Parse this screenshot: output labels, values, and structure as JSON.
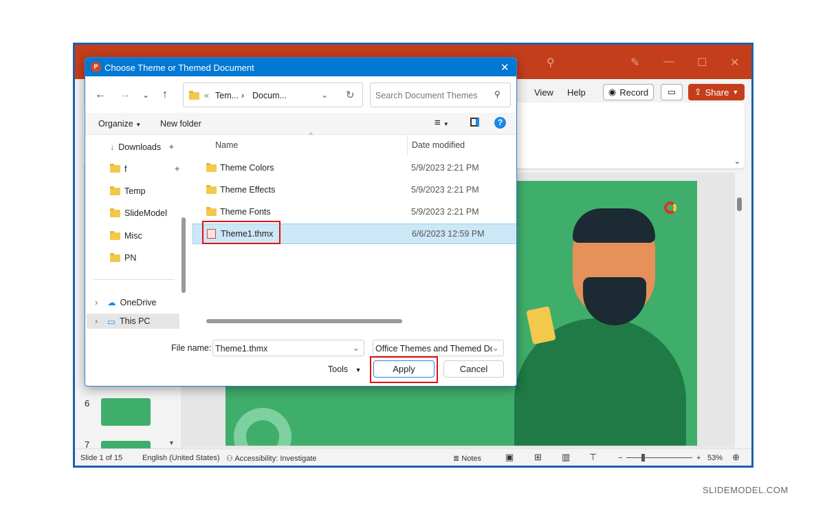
{
  "ppt": {
    "tabs": [
      "View",
      "Help"
    ],
    "record": "Record",
    "share": "Share",
    "slide_numbers": [
      "6",
      "7"
    ],
    "status": {
      "slide": "Slide 1 of 15",
      "language": "English (United States)",
      "accessibility": "Accessibility: Investigate",
      "notes": "Notes",
      "zoom": "53%",
      "zoom_level": 53
    }
  },
  "dialog": {
    "title": "Choose Theme or Themed Document",
    "breadcrumb": [
      "Tem...",
      "Docum..."
    ],
    "search_placeholder": "Search Document Themes",
    "organize": "Organize",
    "new_folder": "New folder",
    "nav": [
      {
        "label": "Downloads",
        "icon": "download-icon",
        "pinned": true
      },
      {
        "label": "f",
        "icon": "folder-icon",
        "pinned": true
      },
      {
        "label": "Temp",
        "icon": "folder-icon"
      },
      {
        "label": "SlideModel",
        "icon": "folder-icon"
      },
      {
        "label": "Misc",
        "icon": "folder-icon"
      },
      {
        "label": "PN",
        "icon": "folder-icon"
      },
      {
        "label": "OneDrive",
        "icon": "cloud-icon"
      },
      {
        "label": "This PC",
        "icon": "computer-icon"
      }
    ],
    "columns": {
      "name": "Name",
      "date": "Date modified"
    },
    "files": [
      {
        "name": "Theme Colors",
        "date": "5/9/2023 2:21 PM",
        "type": "folder"
      },
      {
        "name": "Theme Effects",
        "date": "5/9/2023 2:21 PM",
        "type": "folder"
      },
      {
        "name": "Theme Fonts",
        "date": "5/9/2023 2:21 PM",
        "type": "folder"
      },
      {
        "name": "Theme1.thmx",
        "date": "6/6/2023 12:59 PM",
        "type": "thmx",
        "selected": true
      }
    ],
    "file_name_label": "File name:",
    "file_name": "Theme1.thmx",
    "file_type": "Office Themes and Themed Doc",
    "tools": "Tools",
    "apply": "Apply",
    "cancel": "Cancel"
  },
  "watermark": "SLIDEMODEL.COM",
  "colors": {
    "ppt_accent": "#c43e1c",
    "dialog_title": "#0078d4",
    "slide_green": "#3fae6a",
    "highlight": "#e01010"
  }
}
